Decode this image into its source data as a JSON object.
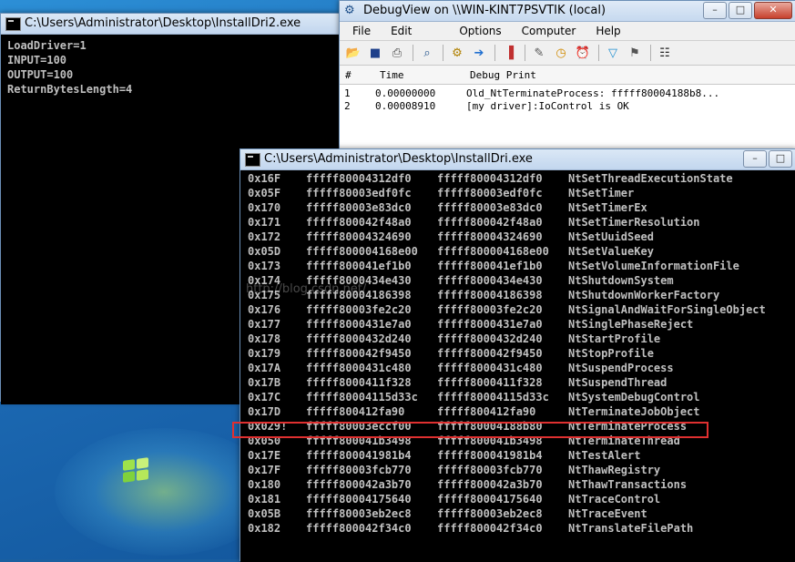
{
  "console1": {
    "title": "C:\\Users\\Administrator\\Desktop\\InstallDri2.exe",
    "lines": [
      "LoadDriver=1",
      "INPUT=100",
      "OUTPUT=100",
      "ReturnBytesLength=4"
    ]
  },
  "debugview": {
    "title": "DebugView on \\\\WIN-KINT7PSVTIK (local)",
    "menu": [
      "File",
      "Edit",
      "Options",
      "Computer",
      "Help"
    ],
    "columns": [
      "#",
      "Time",
      "Debug Print"
    ],
    "rows": [
      {
        "num": "1",
        "time": "0.00000000",
        "text": "Old_NtTerminateProcess: fffff80004188b8..."
      },
      {
        "num": "2",
        "time": "0.00008910",
        "text": "[my driver]:IoControl is OK"
      }
    ]
  },
  "console2": {
    "title": "C:\\Users\\Administrator\\Desktop\\InstallDri.exe",
    "rows": [
      {
        "idx": "0x16F",
        "a": "fffff80004312df0",
        "b": "fffff80004312df0",
        "name": "NtSetThreadExecutionState"
      },
      {
        "idx": "0x05F",
        "a": "fffff80003edf0fc",
        "b": "fffff80003edf0fc",
        "name": "NtSetTimer"
      },
      {
        "idx": "0x170",
        "a": "fffff80003e83dc0",
        "b": "fffff80003e83dc0",
        "name": "NtSetTimerEx"
      },
      {
        "idx": "0x171",
        "a": "fffff800042f48a0",
        "b": "fffff800042f48a0",
        "name": "NtSetTimerResolution"
      },
      {
        "idx": "0x172",
        "a": "fffff80004324690",
        "b": "fffff80004324690",
        "name": "NtSetUuidSeed"
      },
      {
        "idx": "0x05D",
        "a": "fffff800004168e00",
        "b": "fffff800004168e00",
        "name": "NtSetValueKey"
      },
      {
        "idx": "0x173",
        "a": "fffff800041ef1b0",
        "b": "fffff800041ef1b0",
        "name": "NtSetVolumeInformationFile"
      },
      {
        "idx": "0x174",
        "a": "fffff8000434e430",
        "b": "fffff8000434e430",
        "name": "NtShutdownSystem"
      },
      {
        "idx": "0x175",
        "a": "fffff80004186398",
        "b": "fffff80004186398",
        "name": "NtShutdownWorkerFactory"
      },
      {
        "idx": "0x176",
        "a": "fffff80003fe2c20",
        "b": "fffff80003fe2c20",
        "name": "NtSignalAndWaitForSingleObject"
      },
      {
        "idx": "0x177",
        "a": "fffff8000431e7a0",
        "b": "fffff8000431e7a0",
        "name": "NtSinglePhaseReject"
      },
      {
        "idx": "0x178",
        "a": "fffff8000432d240",
        "b": "fffff8000432d240",
        "name": "NtStartProfile"
      },
      {
        "idx": "0x179",
        "a": "fffff800042f9450",
        "b": "fffff800042f9450",
        "name": "NtStopProfile"
      },
      {
        "idx": "0x17A",
        "a": "fffff8000431c480",
        "b": "fffff8000431c480",
        "name": "NtSuspendProcess"
      },
      {
        "idx": "0x17B",
        "a": "fffff8000411f328",
        "b": "fffff8000411f328",
        "name": "NtSuspendThread"
      },
      {
        "idx": "0x17C",
        "a": "fffff80004115d33c",
        "b": "fffff80004115d33c",
        "name": "NtSystemDebugControl"
      },
      {
        "idx": "0x17D",
        "a": "fffff800412fa90",
        "b": "fffff800412fa90",
        "name": "NtTerminateJobObject"
      },
      {
        "idx": "0x029!",
        "a": "fffff80003eccf00",
        "b": "fffff80004188b80",
        "name": "NtTerminateProcess"
      },
      {
        "idx": "0x050",
        "a": "fffff800041b3498",
        "b": "fffff800041b3498",
        "name": "NtTerminateThread"
      },
      {
        "idx": "0x17E",
        "a": "fffff800041981b4",
        "b": "fffff800041981b4",
        "name": "NtTestAlert"
      },
      {
        "idx": "0x17F",
        "a": "fffff80003fcb770",
        "b": "fffff80003fcb770",
        "name": "NtThawRegistry"
      },
      {
        "idx": "0x180",
        "a": "fffff800042a3b70",
        "b": "fffff800042a3b70",
        "name": "NtThawTransactions"
      },
      {
        "idx": "0x181",
        "a": "fffff80004175640",
        "b": "fffff80004175640",
        "name": "NtTraceControl"
      },
      {
        "idx": "0x05B",
        "a": "fffff80003eb2ec8",
        "b": "fffff80003eb2ec8",
        "name": "NtTraceEvent"
      },
      {
        "idx": "0x182",
        "a": "fffff800042f34c0",
        "b": "fffff800042f34c0",
        "name": "NtTranslateFilePath"
      }
    ]
  },
  "colors": {
    "highlight": "#e03030",
    "console_bg": "#000000",
    "console_fg": "#c0c0c0"
  }
}
